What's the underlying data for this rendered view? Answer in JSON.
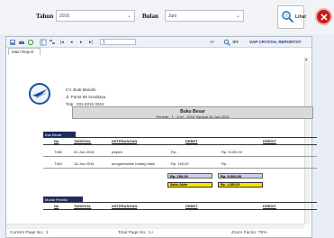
{
  "filters": {
    "year_label": "Tahun",
    "year_value": "2016",
    "month_label": "Bulan",
    "month_value": "Juni",
    "view_button": "Lihat"
  },
  "toolbar": {
    "page_input": "1",
    "export_label": "SAP CRYSTAL REPORTS®"
  },
  "report_tab": "Main Report",
  "company": {
    "name": "CV. Budi Mandiri",
    "address": "Jl. Panta 88 Surabaya",
    "phone": "Telp : 031-8319 3044"
  },
  "report": {
    "title": "Buku Besar",
    "period": "Periode : 1 - Juni - 2016   Sampai   30-Jun-2016"
  },
  "section1": {
    "title": "Kas Besar",
    "headers": [
      "No",
      "TANGGAL",
      "KETERANGAN",
      "DEBET",
      "KREDIT"
    ],
    "rows": [
      {
        "no": "T460",
        "date": "02-Jun-2016",
        "desc": "pinjam",
        "debet": "Rp. -",
        "kredit": "Rp. 5.000,00"
      },
      {
        "no": "T461",
        "date": "14-Jun-2016",
        "desc": "pengambalian hutang bank",
        "debet": "Rp. 150,00",
        "kredit": "Rp. -"
      }
    ],
    "total_debet": "Rp. 150,00",
    "total_kredit": "Rp. 5.000,00",
    "saldo_label": "Saldo Akhir",
    "saldo_value": "Rp. -4.850,00"
  },
  "section2": {
    "title": "Modal Pemilik",
    "headers": [
      "No",
      "TANGGAL",
      "KETERANGAN",
      "DEBET",
      "KREDIT"
    ]
  },
  "status": {
    "current_page": "Current Page No.: 1",
    "total_pages": "Total Page No.: 1+",
    "zoom": "Zoom Factor: 75%"
  }
}
